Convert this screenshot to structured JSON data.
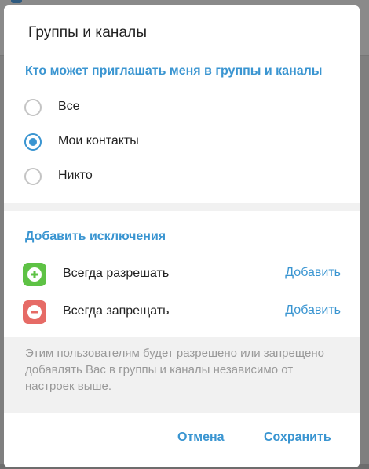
{
  "dialog": {
    "title": "Группы и каналы",
    "who_can_invite": {
      "header": "Кто может приглашать меня в группы и каналы",
      "options": [
        {
          "label": "Все",
          "checked": false
        },
        {
          "label": "Мои контакты",
          "checked": true
        },
        {
          "label": "Никто",
          "checked": false
        }
      ]
    },
    "exceptions": {
      "header": "Добавить исключения",
      "always_allow": {
        "label": "Всегда разрешать",
        "action": "Добавить",
        "icon": "plus-icon",
        "color": "#5ec245"
      },
      "always_deny": {
        "label": "Всегда запрещать",
        "action": "Добавить",
        "icon": "minus-icon",
        "color": "#e66b66"
      }
    },
    "note": "Этим пользователям будет разрешено или запрещено добавлять Вас в группы и каналы независимо от настроек выше.",
    "buttons": {
      "cancel": "Отмена",
      "save": "Сохранить"
    }
  },
  "colors": {
    "accent": "#3a95d1",
    "overlay": "#7f7f7f"
  }
}
